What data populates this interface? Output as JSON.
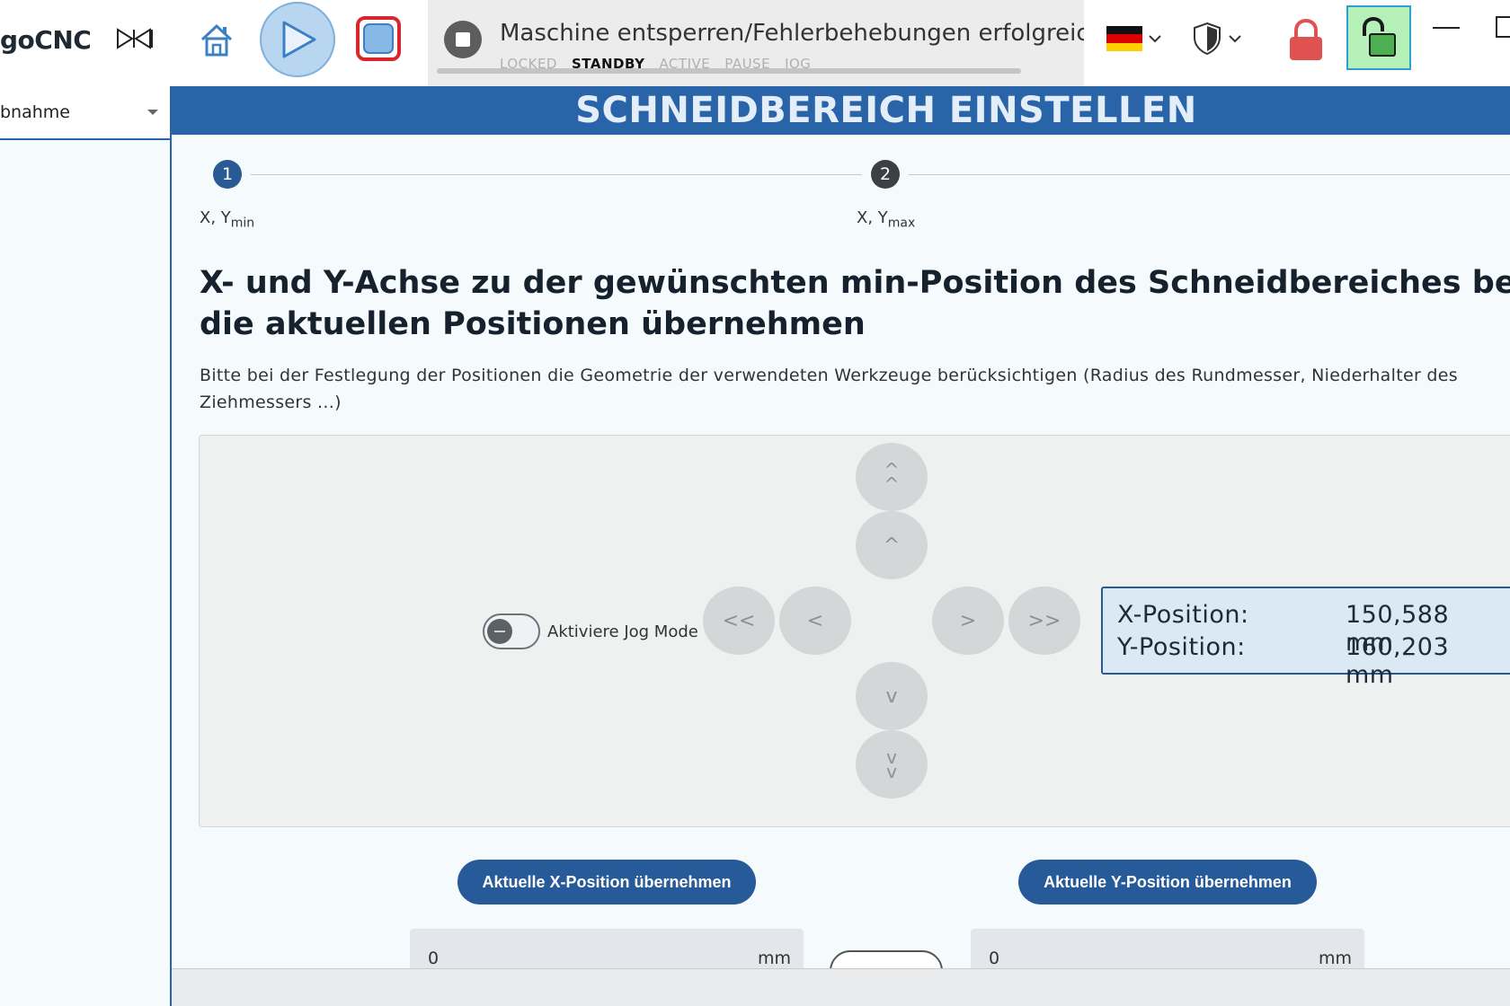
{
  "app": {
    "name": "goCNC"
  },
  "topbar": {
    "status_message": "Maschine entsperren/Fehlerbehebungen erfolgreich ausge",
    "states": [
      {
        "label": "LOCKED",
        "active": false
      },
      {
        "label": "STANDBY",
        "active": true
      },
      {
        "label": "ACTIVE",
        "active": false
      },
      {
        "label": "PAUSE",
        "active": false
      },
      {
        "label": "JOG",
        "active": false
      }
    ],
    "language": "de"
  },
  "sidebar": {
    "selected_value": "bnahme"
  },
  "page": {
    "title": "SCHNEIDBEREICH EINSTELLEN",
    "steps": [
      {
        "number": "1",
        "label_main": "X, Y",
        "label_sub": "min"
      },
      {
        "number": "2",
        "label_main": "X, Y",
        "label_sub": "max"
      }
    ],
    "heading_line1": "X- und Y-Achse zu der gewünschten min-Position des Schneidbereiches bewegen und d",
    "heading_line2": "die aktuellen Positionen übernehmen",
    "description": "Bitte bei der Festlegung der Positionen die Geometrie der verwendeten Werkzeuge berücksichtigen (Radius des Rundmesser, Niederhalter des Ziehmessers ...)"
  },
  "jog": {
    "toggle_label": "Aktiviere Jog Mode",
    "toggle_on": false,
    "buttons": {
      "up_fast": "^^",
      "up": "^",
      "left_fast": "<<",
      "left": "<",
      "right": ">",
      "right_fast": ">>",
      "down": "v",
      "down_fast": "vv"
    }
  },
  "position": {
    "x_label": "X-Position:",
    "x_value": "150,588 mm",
    "y_label": "Y-Position:",
    "y_value": "160,203 mm"
  },
  "actions": {
    "take_x": "Aktuelle X-Position übernehmen",
    "take_y": "Aktuelle Y-Position übernehmen"
  },
  "fields": {
    "x_value": "0",
    "y_value": "0",
    "unit": "mm"
  },
  "colors": {
    "accent": "#2a64a8",
    "unlock_bg": "#b5f0b8",
    "stop_red": "#d9262c",
    "lock_red": "#e0524f"
  }
}
